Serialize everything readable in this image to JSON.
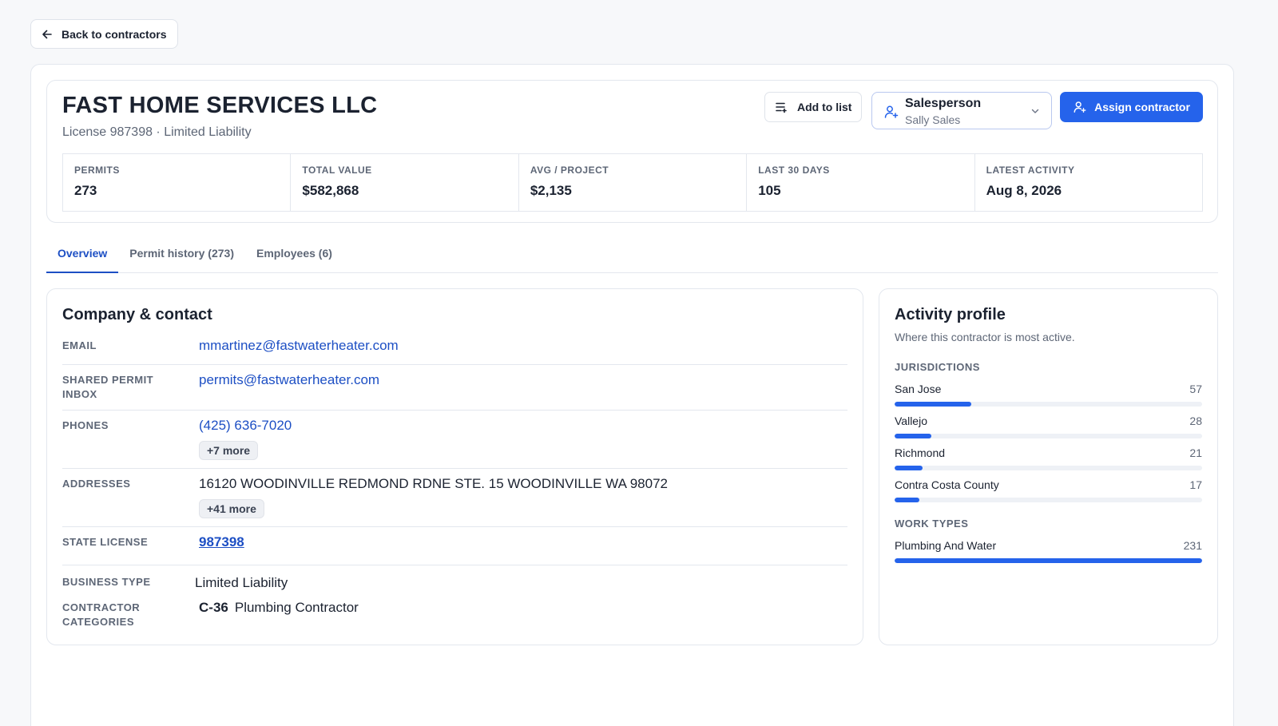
{
  "back_button": {
    "label": "Back to contractors"
  },
  "company": {
    "name": "FAST HOME SERVICES LLC",
    "subtitle": "License 987398 · Limited Liability"
  },
  "actions": {
    "add_to_list": "Add to list",
    "salesperson_label": "Salesperson",
    "salesperson_value": "Sally Sales",
    "assign": "Assign contractor"
  },
  "stats": [
    {
      "label": "PERMITS",
      "value": "273"
    },
    {
      "label": "TOTAL VALUE",
      "value": "$582,868"
    },
    {
      "label": "AVG / PROJECT",
      "value": "$2,135"
    },
    {
      "label": "LAST 30 DAYS",
      "value": "105"
    },
    {
      "label": "LATEST ACTIVITY",
      "value": "Aug 8, 2026"
    }
  ],
  "tabs": [
    {
      "label": "Overview",
      "active": true
    },
    {
      "label": "Permit history (273)",
      "active": false
    },
    {
      "label": "Employees (6)",
      "active": false
    }
  ],
  "contact": {
    "title": "Company & contact",
    "email_label": "EMAIL",
    "email": "mmartinez@fastwaterheater.com",
    "shared_label": "SHARED PERMIT INBOX",
    "shared": "permits@fastwaterheater.com",
    "phones_label": "PHONES",
    "phone": "(425) 636-7020",
    "phones_more": "+7 more",
    "addresses_label": "ADDRESSES",
    "address": "16120 WOODINVILLE REDMOND RDNE STE. 15 WOODINVILLE WA 98072",
    "addresses_more": "+41 more",
    "license_label": "STATE LICENSE",
    "license": "987398",
    "business_type_label": "BUSINESS TYPE",
    "business_type": "Limited Liability",
    "categories_label": "CONTRACTOR CATEGORIES",
    "category_code": "C-36",
    "category_name": "Plumbing Contractor"
  },
  "activity": {
    "title": "Activity profile",
    "subtitle": "Where this contractor is most active.",
    "jurisdictions_label": "JURISDICTIONS",
    "jurisdictions": [
      {
        "name": "San Jose",
        "count": 57,
        "fraction": 0.25
      },
      {
        "name": "Vallejo",
        "count": 28,
        "fraction": 0.12
      },
      {
        "name": "Richmond",
        "count": 21,
        "fraction": 0.09
      },
      {
        "name": "Contra Costa County",
        "count": 17,
        "fraction": 0.08
      }
    ],
    "work_types_label": "WORK TYPES",
    "work_types": [
      {
        "name": "Plumbing And Water",
        "count": 231,
        "fraction": 1.0
      }
    ]
  },
  "colors": {
    "accent": "#2563eb",
    "link": "#1d4fc4"
  }
}
